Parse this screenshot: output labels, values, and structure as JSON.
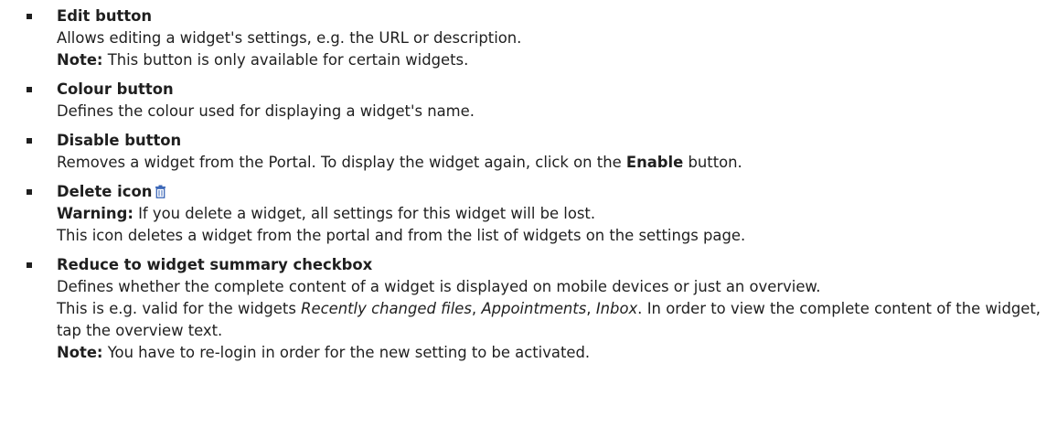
{
  "colors": {
    "text": "#1f1f1f",
    "icon_accent": "#3a66b7"
  },
  "items": [
    {
      "title": "Edit button",
      "desc": "Allows editing a widget's settings, e.g. the URL or description.",
      "note_label": "Note:",
      "note_text": " This button is only available for certain widgets."
    },
    {
      "title": "Colour button",
      "desc": "Defines the colour used for displaying a widget's name."
    },
    {
      "title": "Disable button",
      "desc_prefix": "Removes a widget from the Portal. To display the widget again, click on the ",
      "desc_bold": "Enable",
      "desc_suffix": " button."
    },
    {
      "title": "Delete icon",
      "icon": "trash-icon",
      "warning_label": "Warning:",
      "warning_text": " If you delete a widget, all settings for this widget will be lost.",
      "desc": "This icon deletes a widget from the portal and from the list of widgets on the settings page."
    },
    {
      "title": "Reduce to widget summary checkbox",
      "desc_line1": "Defines whether the complete content of a widget is displayed on mobile devices or just an overview.",
      "desc_p2_prefix": "This is e.g. valid for the widgets ",
      "widget1": "Recently changed files",
      "sep1": ", ",
      "widget2": "Appointments",
      "sep2": ", ",
      "widget3": "Inbox",
      "desc_p2_suffix": ". In order to view the complete content of the widget, tap the overview text.",
      "note_label": "Note:",
      "note_text": " You have to re-login in order for the new setting to be activated."
    }
  ]
}
